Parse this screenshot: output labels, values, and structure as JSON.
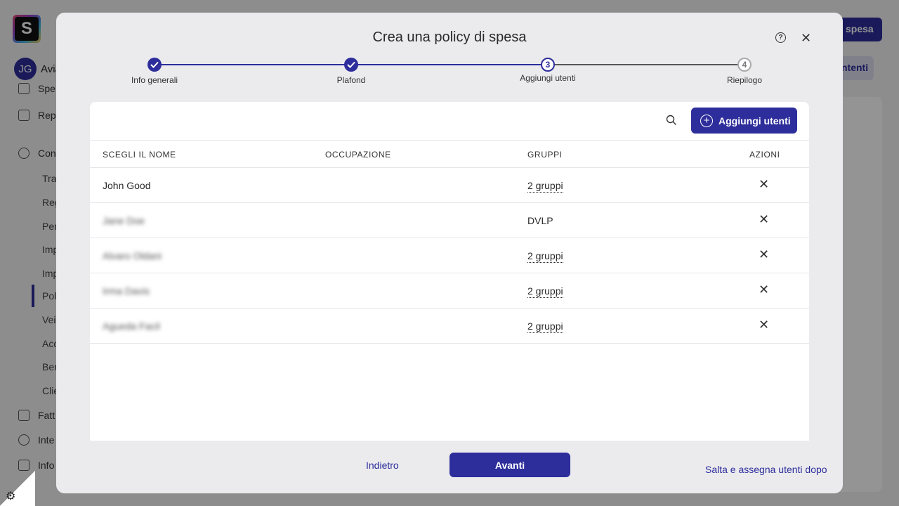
{
  "app": {
    "logo_letter": "S",
    "user": {
      "initials": "JG",
      "name": "Avia"
    },
    "nav": [
      {
        "label": "Spe"
      },
      {
        "label": "Rep"
      },
      {
        "label": "Con"
      },
      {
        "label": "Fatt"
      },
      {
        "label": "Inte"
      },
      {
        "label": "Info"
      }
    ],
    "nav_sub": [
      "Tra",
      "Reg",
      "Per",
      "Imp",
      "Imp",
      "Pol",
      "Vei",
      "Acc",
      "Ben",
      "Clie"
    ],
    "top_button": "spesa",
    "secondary_button": "ntenti"
  },
  "modal": {
    "title": "Crea una policy di spesa",
    "steps": [
      {
        "label": "Info generali",
        "state": "done"
      },
      {
        "label": "Plafond",
        "state": "done"
      },
      {
        "label": "Aggiungi utenti",
        "state": "current",
        "number": "3"
      },
      {
        "label": "Riepilogo",
        "state": "todo",
        "number": "4"
      }
    ],
    "add_button": "Aggiungi utenti",
    "columns": [
      "SCEGLI IL NOME",
      "OCCUPAZIONE",
      "GRUPPI",
      "AZIONI"
    ],
    "rows": [
      {
        "name": "John Good",
        "occupation": "",
        "groups": "2 gruppi",
        "groups_link": true,
        "blurred": false
      },
      {
        "name": "Jane Doe",
        "occupation": "",
        "groups": "DVLP",
        "groups_link": false,
        "blurred": true
      },
      {
        "name": "Alvaro Oldani",
        "occupation": "",
        "groups": "2 gruppi",
        "groups_link": true,
        "blurred": true
      },
      {
        "name": "Irma Davis",
        "occupation": "",
        "groups": "2 gruppi",
        "groups_link": true,
        "blurred": true
      },
      {
        "name": "Agueda Facil",
        "occupation": "",
        "groups": "2 gruppi",
        "groups_link": true,
        "blurred": true
      }
    ],
    "back_label": "Indietro",
    "next_label": "Avanti",
    "skip_label": "Salta e assegna utenti dopo"
  },
  "colors": {
    "accent": "#2d2d9c"
  }
}
